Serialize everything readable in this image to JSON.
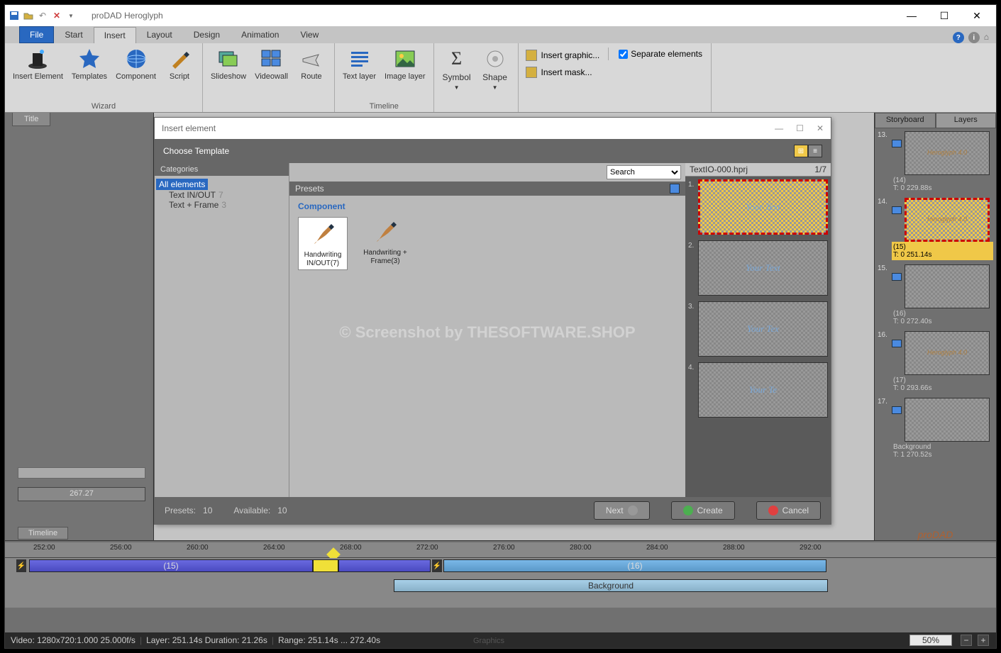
{
  "app_title": "proDAD Heroglyph",
  "menu": {
    "file": "File",
    "start": "Start",
    "insert": "Insert",
    "layout": "Layout",
    "design": "Design",
    "animation": "Animation",
    "view": "View"
  },
  "ribbon": {
    "wizard": {
      "label": "Wizard",
      "insert_element": "Insert Element",
      "templates": "Templates",
      "component": "Component",
      "script": "Script"
    },
    "wizard2": {
      "slideshow": "Slideshow",
      "videowall": "Videowall",
      "route": "Route"
    },
    "timeline": {
      "label": "Timeline",
      "text_layer": "Text layer",
      "image_layer": "Image layer"
    },
    "timeline2": {
      "symbol": "Symbol",
      "shape": "Shape"
    },
    "graphics": {
      "label": "Graphics",
      "insert_graphic": "Insert graphic...",
      "insert_mask": "Insert mask...",
      "separate": "Separate elements"
    }
  },
  "left_tab": "Title",
  "time_value": "267.27",
  "dialog": {
    "title": "Insert element",
    "header": "Choose Template",
    "categories_hdr": "Categories",
    "cat_all": "All elements",
    "cat_text_io": "Text IN/OUT",
    "cat_text_io_n": "7",
    "cat_text_frame": "Text + Frame",
    "cat_text_frame_n": "3",
    "search": "Search",
    "presets_hdr": "Presets",
    "component_lbl": "Component",
    "preset1": "Handwriting IN/OUT(7)",
    "preset2": "Handwriting + Frame(3)",
    "preview_file": "TextIO-000.hprj",
    "preview_count": "1/7",
    "pv_text": "Your Text",
    "pv_text2": "Your Tex",
    "pv_text3": "Your Te",
    "foot_presets": "Presets:",
    "foot_presets_n": "10",
    "foot_avail": "Available:",
    "foot_avail_n": "10",
    "btn_next": "Next",
    "btn_create": "Create",
    "btn_cancel": "Cancel"
  },
  "watermark": "© Screenshot by THESOFTWARE.SHOP",
  "storyboard": {
    "tab_sb": "Storyboard",
    "tab_layers": "Layers",
    "items": [
      {
        "n": "13.",
        "txt": "Heroglyph 4.0",
        "id": "(14)",
        "t": "T: 0  229.88s"
      },
      {
        "n": "14.",
        "txt": "Heroglyph 4.0",
        "id": "(15)",
        "t": "T: 0  251.14s",
        "sel": true
      },
      {
        "n": "15.",
        "txt": "",
        "id": "(16)",
        "t": "T: 0  272.40s"
      },
      {
        "n": "16.",
        "txt": "Heroglyph 4.0",
        "id": "(17)",
        "t": "T: 0  293.66s"
      },
      {
        "n": "17.",
        "txt": "",
        "id": "Background",
        "t": "T: 1  270.52s"
      }
    ]
  },
  "timeline": {
    "tab": "Timeline",
    "ticks": [
      "252:00",
      "256:00",
      "260:00",
      "264:00",
      "268:00",
      "272:00",
      "276:00",
      "280:00",
      "284:00",
      "288:00",
      "292:00"
    ],
    "clip15": "(15)",
    "clip16": "(16)",
    "clip_bg": "Background"
  },
  "status": {
    "video": "Video:  1280x720:1.000  25.000f/s",
    "layer": "Layer: 251.14s  Duration: 21.26s",
    "range": "Range: 251.14s ... 272.40s",
    "zoom": "50%"
  }
}
